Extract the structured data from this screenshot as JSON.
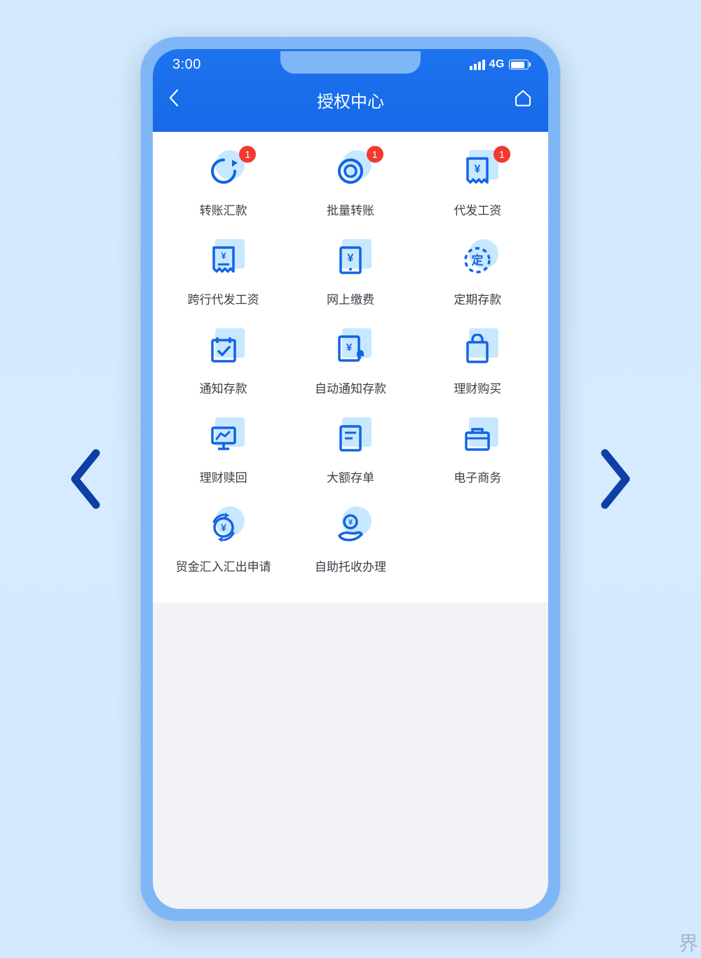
{
  "status": {
    "time": "3:00",
    "network": "4G"
  },
  "nav": {
    "title": "授权中心"
  },
  "grid": {
    "items": [
      {
        "label": "转账汇款",
        "badge": "1"
      },
      {
        "label": "批量转账",
        "badge": "1"
      },
      {
        "label": "代发工资",
        "badge": "1"
      },
      {
        "label": "跨行代发工资"
      },
      {
        "label": "网上缴费"
      },
      {
        "label": "定期存款"
      },
      {
        "label": "通知存款"
      },
      {
        "label": "自动通知存款"
      },
      {
        "label": "理财购买"
      },
      {
        "label": "理财赎回"
      },
      {
        "label": "大额存单"
      },
      {
        "label": "电子商务"
      },
      {
        "label": "贸金汇入汇出申请"
      },
      {
        "label": "自助托收办理"
      }
    ]
  },
  "watermark": "界",
  "colors": {
    "primary": "#1363e5",
    "accent": "#c8e8ff",
    "badge": "#f13a2e"
  }
}
